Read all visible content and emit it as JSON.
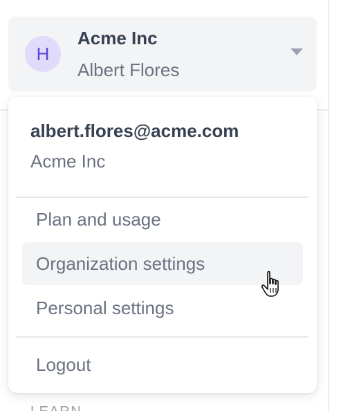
{
  "org_switcher": {
    "avatar_letter": "H",
    "org_name": "Acme Inc",
    "user_name": "Albert Flores",
    "chevron_icon": "chevron-down-icon"
  },
  "dropdown": {
    "email": "albert.flores@acme.com",
    "org": "Acme Inc",
    "items": [
      {
        "label": "Plan and usage",
        "hovered": false
      },
      {
        "label": "Organization settings",
        "hovered": true
      },
      {
        "label": "Personal settings",
        "hovered": false
      },
      {
        "label": "Logout",
        "hovered": false
      }
    ]
  },
  "background": {
    "section_label": "LEARN"
  },
  "colors": {
    "avatar_bg": "#e0dbfb",
    "avatar_fg": "#5b45d6",
    "hover_bg": "#f3f4f6"
  }
}
